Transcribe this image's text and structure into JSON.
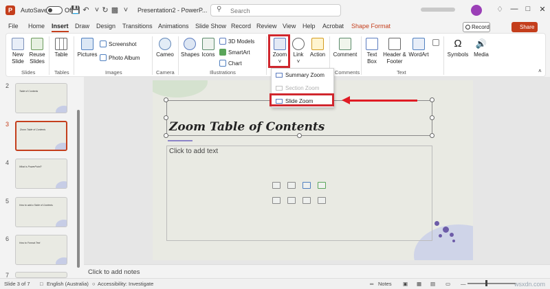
{
  "titlebar": {
    "app_logo": "P",
    "autosave_label": "AutoSave",
    "autosave_state": "Off",
    "doc_title": "Presentation2 - PowerP...",
    "search_placeholder": "Search",
    "qat_icons": [
      "save-icon",
      "undo-icon",
      "redo-icon",
      "slideshow-icon",
      "dropdown-icon"
    ],
    "window_icons": [
      "diamond-icon",
      "minimize-icon",
      "maximize-icon",
      "close-icon"
    ]
  },
  "menu": {
    "tabs": [
      "File",
      "Home",
      "Insert",
      "Draw",
      "Design",
      "Transitions",
      "Animations",
      "Slide Show",
      "Record",
      "Review",
      "View",
      "Help",
      "Acrobat",
      "Shape Format"
    ],
    "active_tab": "Insert",
    "record_label": "Record",
    "share_label": "Share"
  },
  "ribbon": {
    "new_slide": "New Slide",
    "reuse_slides": "Reuse Slides",
    "slides_group": "Slides",
    "table": "Table",
    "tables_group": "Tables",
    "pictures": "Pictures",
    "screenshot": "Screenshot",
    "photo_album": "Photo Album",
    "images_group": "Images",
    "cameo": "Cameo",
    "camera_group": "Camera",
    "shapes": "Shapes",
    "icons": "Icons",
    "models_3d": "3D Models",
    "smartart": "SmartArt",
    "chart": "Chart",
    "illustrations_group": "Illustrations",
    "zoom": "Zoom",
    "link": "Link",
    "action": "Action",
    "comment": "Comment",
    "comments_group": "Comments",
    "text_box": "Text Box",
    "header_footer": "Header & Footer",
    "wordart": "WordArt",
    "text_group": "Text",
    "symbols": "Symbols",
    "media": "Media"
  },
  "zoom_menu": {
    "summary_zoom": "Summary Zoom",
    "section_zoom": "Section Zoom",
    "slide_zoom": "Slide Zoom"
  },
  "thumbnails": [
    {
      "number": "2",
      "title": "Table of Contents"
    },
    {
      "number": "3",
      "title": "Zoom Table of Contents",
      "selected": true
    },
    {
      "number": "4",
      "title": "What is PowerPoint?"
    },
    {
      "number": "5",
      "title": "How to add a Table of Contents"
    },
    {
      "number": "6",
      "title": "How to Format Text"
    },
    {
      "number": "7",
      "title": ""
    }
  ],
  "slide": {
    "title": "Zoom Table of Contents",
    "content_placeholder": "Click to add text"
  },
  "notes_placeholder": "Click to add notes",
  "status": {
    "slide_count": "Slide 3 of 7",
    "language": "English (Australia)",
    "accessibility": "Accessibility: Investigate",
    "notes": "Notes",
    "watermark": "wsxdn.com"
  },
  "colors": {
    "accent": "#c43e1c",
    "highlight": "#d0262d",
    "arrow": "#e01b24"
  }
}
